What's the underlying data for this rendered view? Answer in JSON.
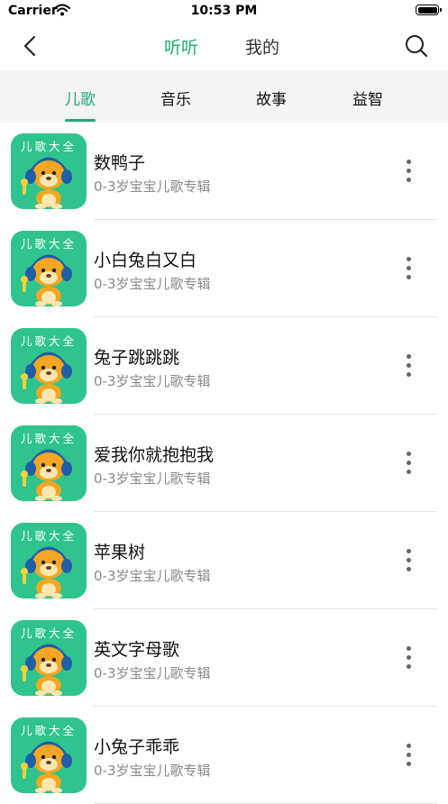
{
  "status_bar": {
    "carrier": "Carrier",
    "time": "10:53 PM"
  },
  "nav": {
    "back_icon": "chevron-left-icon",
    "segments": [
      {
        "label": "听听",
        "active": true
      },
      {
        "label": "我的",
        "active": false
      }
    ],
    "search_icon": "search-icon"
  },
  "tabs": [
    {
      "label": "儿歌",
      "active": true
    },
    {
      "label": "音乐",
      "active": false
    },
    {
      "label": "故事",
      "active": false
    },
    {
      "label": "益智",
      "active": false
    }
  ],
  "list": {
    "thumb_label": "儿歌大全",
    "items": [
      {
        "title": "数鸭子",
        "subtitle": "0-3岁宝宝儿歌专辑"
      },
      {
        "title": "小白兔白又白",
        "subtitle": "0-3岁宝宝儿歌专辑"
      },
      {
        "title": "兔子跳跳跳",
        "subtitle": "0-3岁宝宝儿歌专辑"
      },
      {
        "title": "爱我你就抱抱我",
        "subtitle": "0-3岁宝宝儿歌专辑"
      },
      {
        "title": "苹果树",
        "subtitle": "0-3岁宝宝儿歌专辑"
      },
      {
        "title": "英文字母歌",
        "subtitle": "0-3岁宝宝儿歌专辑"
      },
      {
        "title": "小兔子乖乖",
        "subtitle": "0-3岁宝宝儿歌专辑"
      }
    ]
  },
  "colors": {
    "accent": "#22a874",
    "thumb_bg": "#2fc48d",
    "tabs_bg": "#f4f4f4",
    "subtitle": "#888888"
  }
}
